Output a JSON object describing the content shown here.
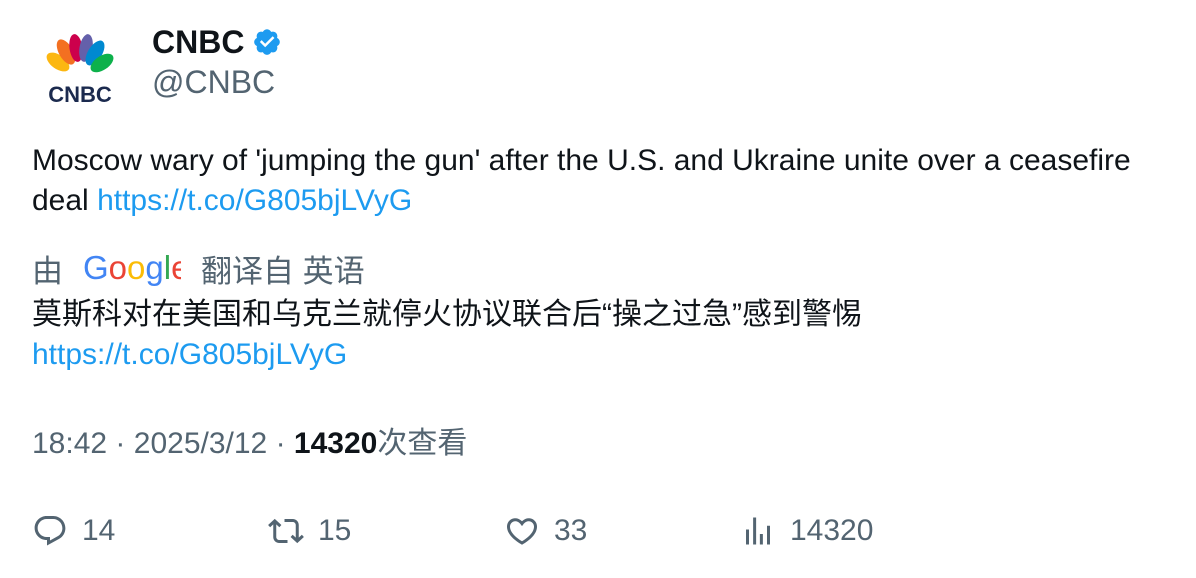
{
  "author": {
    "logo_text": "CNBC",
    "name": "CNBC",
    "handle": "@CNBC",
    "verified": true
  },
  "tweet": {
    "text": "Moscow wary of 'jumping the gun' after the U.S. and Ukraine unite over a ceasefire deal ",
    "link": "https://t.co/G805bjLVyG"
  },
  "translation": {
    "prefix": "由",
    "provider": "Google",
    "suffix": "翻译自 英语",
    "text": "莫斯科对在美国和乌克兰就停火协议联合后“操之过急”感到警惕",
    "link": "https://t.co/G805bjLVyG"
  },
  "meta": {
    "time": "18:42",
    "separator": "·",
    "date": "2025/3/12",
    "views_count": "14320",
    "views_label": "次查看"
  },
  "actions": {
    "replies": "14",
    "retweets": "15",
    "likes": "33",
    "views": "14320"
  },
  "colors": {
    "link": "#1d9bf0",
    "secondary_text": "#536471",
    "verified": "#1d9bf0"
  },
  "icons": [
    "cnbc-peacock-logo",
    "verified-badge-icon",
    "google-logo",
    "reply-icon",
    "retweet-icon",
    "like-icon",
    "views-icon"
  ]
}
